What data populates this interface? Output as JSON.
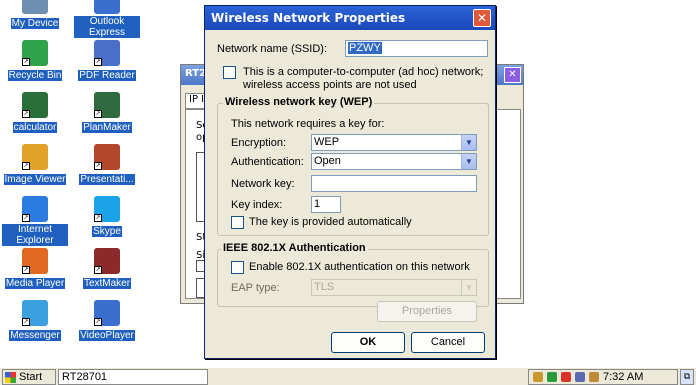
{
  "desktop_icons": [
    {
      "label": "My Device",
      "icon": "my-device-icon",
      "color": "#6f8fb0"
    },
    {
      "label": "Outlook Express",
      "icon": "outlook-express-icon",
      "color": "#3b6fcf"
    },
    {
      "label": "Recycle Bin",
      "icon": "recycle-bin-icon",
      "color": "#2fa34a"
    },
    {
      "label": "PDF Reader",
      "icon": "pdf-reader-icon",
      "color": "#4a6fc7"
    },
    {
      "label": "calculator",
      "icon": "calculator-icon",
      "color": "#2a6f3a"
    },
    {
      "label": "PlanMaker",
      "icon": "planmaker-icon",
      "color": "#2f6b3e"
    },
    {
      "label": "Image Viewer",
      "icon": "image-viewer-icon",
      "color": "#e2a22a"
    },
    {
      "label": "Presentati...",
      "icon": "presentations-icon",
      "color": "#b5462e"
    },
    {
      "label": "Internet Explorer",
      "icon": "internet-explorer-icon",
      "color": "#2b7be0"
    },
    {
      "label": "Skype",
      "icon": "skype-icon",
      "color": "#1aa3e8"
    },
    {
      "label": "Media Player",
      "icon": "media-player-icon",
      "color": "#e06a1f"
    },
    {
      "label": "TextMaker",
      "icon": "textmaker-icon",
      "color": "#8a2a2a"
    },
    {
      "label": "Messenger",
      "icon": "messenger-icon",
      "color": "#3aa0e0"
    },
    {
      "label": "VideoPlayer",
      "icon": "video-player-icon",
      "color": "#3b6fcf"
    }
  ],
  "background_window": {
    "title_fragment": "RT2",
    "tab_fragment": "IP I",
    "line1_fragment": "Se",
    "line2_fragment": "op",
    "line3_fragment": "St",
    "line4_fragment": "Si"
  },
  "dialog": {
    "title": "Wireless Network Properties",
    "ssid_label": "Network name (SSID):",
    "ssid_value": "PZWY",
    "adhoc_line1": "This is a computer-to-computer (ad hoc) network;",
    "adhoc_line2": "wireless access points are not used",
    "wep_group": "Wireless network key (WEP)",
    "requires_key": "This network requires a key for:",
    "encryption_label": "Encryption:",
    "encryption_value": "WEP",
    "authentication_label": "Authentication:",
    "authentication_value": "Open",
    "network_key_label": "Network key:",
    "network_key_value": "",
    "key_index_label": "Key index:",
    "key_index_value": "1",
    "auto_key_label": "The key is provided automatically",
    "ieee_group": "IEEE 802.1X Authentication",
    "enable_8021x_label": "Enable 802.1X authentication on this network",
    "eap_label": "EAP type:",
    "eap_value": "TLS",
    "properties_button": "Properties",
    "ok_button": "OK",
    "cancel_button": "Cancel"
  },
  "taskbar": {
    "start_label": "Start",
    "task_label": "RT28701",
    "clock": "7:32 AM"
  }
}
